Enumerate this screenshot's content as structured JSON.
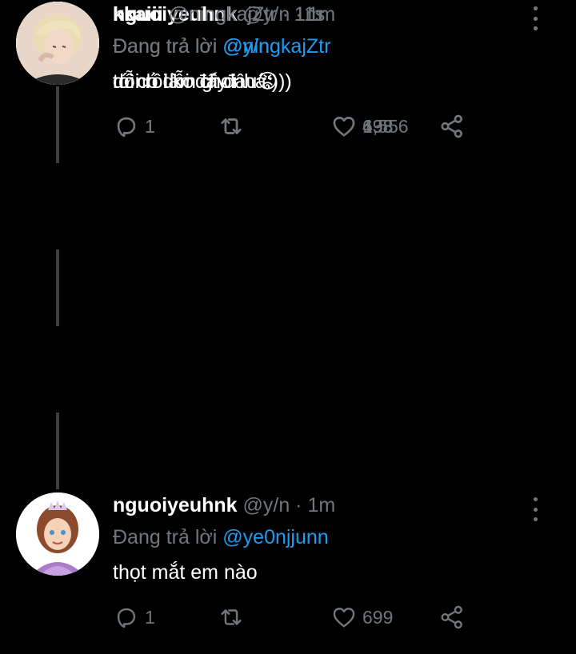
{
  "tweets": [
    {
      "avatar": "princess-avatar",
      "name": "nguoiyeuhnk",
      "meta": " @y/n · 1m",
      "replying_prefix": "Đang trả lời ",
      "replying_to": "@ye0njjunn",
      "text": "thọt mắt em nào",
      "replies": "1",
      "retweets": "",
      "likes": "699"
    },
    {
      "avatar": "blond-person-avatar",
      "name": "kkaiii",
      "meta": " @ningkajZtr · 1m",
      "replying_prefix": "Đang trả lời ",
      "replying_to": "@y/n",
      "text": "mình dỗi đấy nhá:)))",
      "replies": "1",
      "retweets": "",
      "likes": "1,556"
    },
    {
      "avatar": "princess-avatar",
      "name": "nguoiyeuhnk",
      "meta": " @y/n · 1m",
      "replying_prefix": "Đang trả lời ",
      "replying_to": "@ningkajZtr",
      "text": "tớ có làm gì đâu😡",
      "replies": "1",
      "retweets": "",
      "likes": "493"
    },
    {
      "avatar": "blond-person-avatar",
      "name": "kkaiii",
      "meta": " @ningkajZtr · 11s",
      "replying_prefix": "Đang trả lời ",
      "replying_to": "@y/n",
      "text": "dỗi rồi ko choi",
      "replies": "",
      "retweets": "",
      "likes": "638"
    }
  ],
  "colors": {
    "background": "#000000",
    "text": "#ffffff",
    "muted": "#71767b",
    "mention": "#1d9bf0",
    "thread_line": "#3d4145"
  }
}
